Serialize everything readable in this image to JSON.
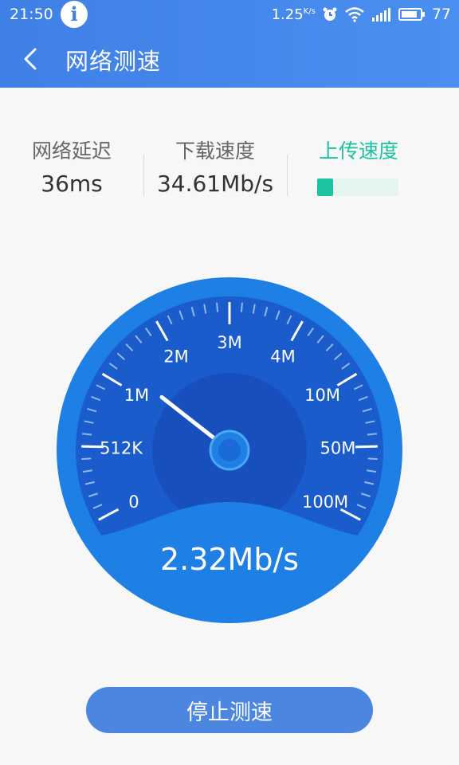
{
  "status_bar": {
    "time": "21:50",
    "net_speed": "1.25",
    "net_speed_unit": "K/s",
    "battery": "77",
    "icons": [
      "info-icon",
      "alarm-icon",
      "wifi-icon",
      "signal-icon",
      "battery-icon"
    ]
  },
  "header": {
    "title": "网络测速",
    "back_icon": "chevron-left-icon"
  },
  "stats": {
    "latency": {
      "label": "网络延迟",
      "value": "36ms"
    },
    "download": {
      "label": "下载速度",
      "value": "34.61Mb/s"
    },
    "upload": {
      "label": "上传速度",
      "progress": 0.2
    }
  },
  "gauge": {
    "labels": [
      "0",
      "512K",
      "1M",
      "2M",
      "3M",
      "4M",
      "10M",
      "50M",
      "100M"
    ],
    "current_speed": "2.32Mb/s",
    "needle_level": 0.28,
    "colors": {
      "outer": "#1e7fe4",
      "face": "#1b5ccd",
      "inner": "#1750bd",
      "needle": "#ffffff"
    }
  },
  "actions": {
    "stop_label": "停止测速"
  },
  "colors": {
    "accent": "#3f80e6",
    "upload": "#1cc3a1",
    "button": "#4b86e0"
  }
}
